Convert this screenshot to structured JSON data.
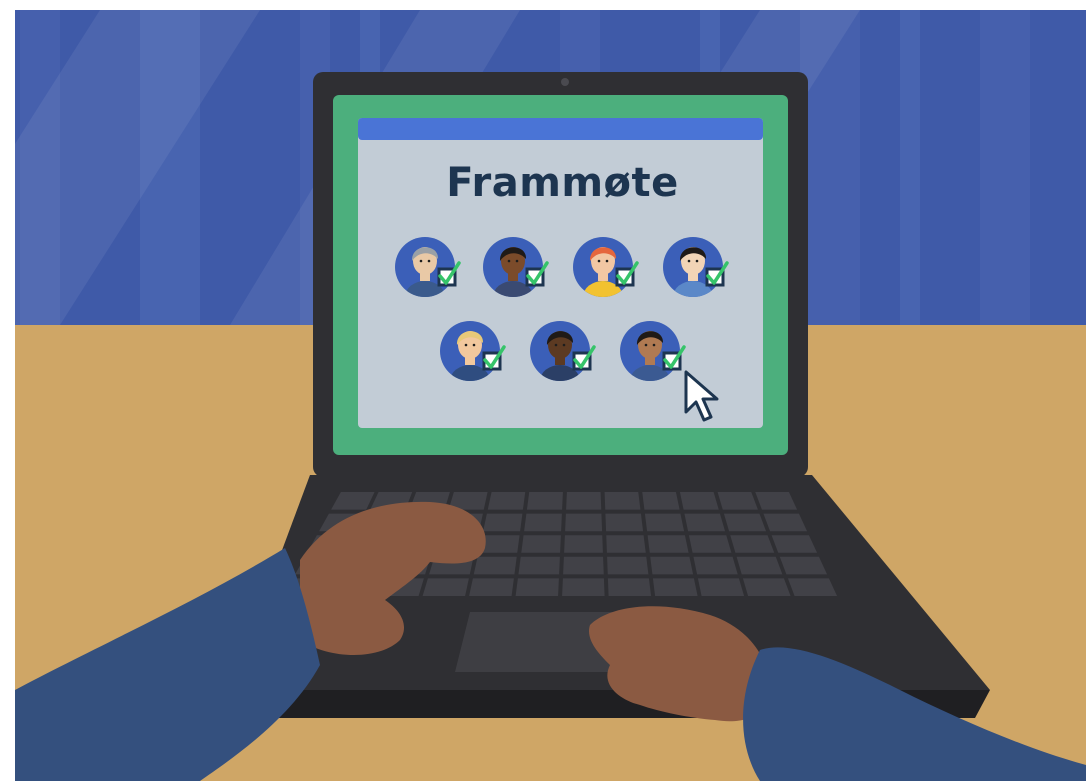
{
  "screen": {
    "title": "Frammøte"
  },
  "attendees": [
    {
      "row": 1,
      "skin": "#e9c9a6",
      "hair": "#9aa0a6",
      "shirt": "#3a5a8c",
      "checked": true
    },
    {
      "row": 1,
      "skin": "#7b4b2a",
      "hair": "#1f1a17",
      "shirt": "#3a4a72",
      "checked": true
    },
    {
      "row": 1,
      "skin": "#f2c7a3",
      "hair": "#e5663d",
      "shirt": "#f2c230",
      "checked": true
    },
    {
      "row": 1,
      "skin": "#f2d4b6",
      "hair": "#1f1a17",
      "shirt": "#5b88c8",
      "checked": true
    },
    {
      "row": 2,
      "skin": "#f2c89d",
      "hair": "#e8c978",
      "shirt": "#2f4d80",
      "checked": true
    },
    {
      "row": 2,
      "skin": "#5c3a22",
      "hair": "#1f1a17",
      "shirt": "#2b3f66",
      "checked": true
    },
    {
      "row": 2,
      "skin": "#b07a52",
      "hair": "#1f1a17",
      "shirt": "#3b5a92",
      "checked": true
    }
  ],
  "colors": {
    "wall": "#3f5aa8",
    "wall_stripe": "#5570bb",
    "desk": "#cfa666",
    "laptop_body": "#2f2f33",
    "laptop_screen_frame": "#4caf7d",
    "screen_bg": "#c2ccd6",
    "screen_topbar": "#4a74d6",
    "title_text": "#1d3550",
    "check_box": "#1d3550",
    "check_mark": "#36c46a",
    "sleeve": "#34507e",
    "hand": "#8b5a42"
  },
  "icons": {
    "cursor": "mouse-cursor-icon",
    "check": "checkbox-checked-icon",
    "camera": "webcam-icon"
  }
}
